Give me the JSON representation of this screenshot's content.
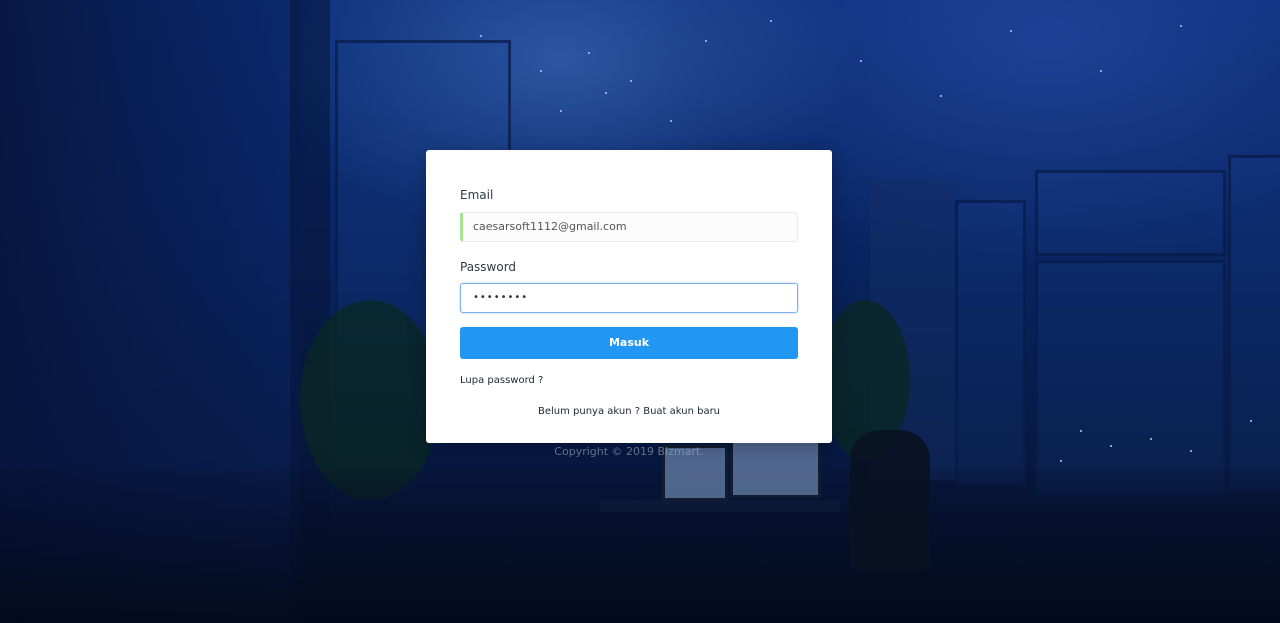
{
  "login": {
    "email_label": "Email",
    "email_value": "caesarsoft1112@gmail.com",
    "password_label": "Password",
    "password_value": "••••••••",
    "submit_label": "Masuk",
    "forgot_password": "Lupa password ?",
    "register_link": "Belum punya akun ? Buat akun baru"
  },
  "footer": {
    "copyright": "Copyright © 2019 Bizmart."
  },
  "colors": {
    "primary_button": "#2196f3",
    "focus_border": "#7fb2ec",
    "email_accent": "#a8e38f"
  }
}
